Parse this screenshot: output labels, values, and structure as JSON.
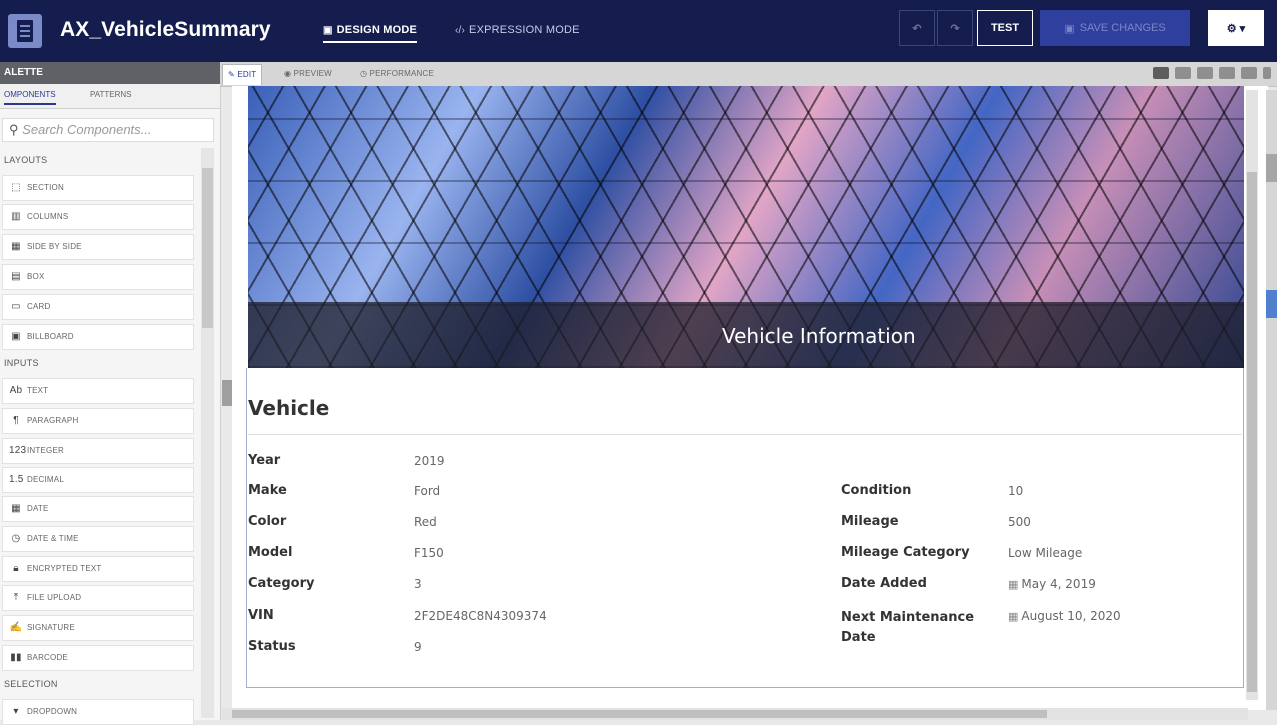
{
  "header": {
    "title": "AX_VehicleSummary",
    "modes": [
      {
        "label": "DESIGN MODE",
        "icon": "design-icon",
        "active": true
      },
      {
        "label": "EXPRESSION MODE",
        "icon": "code-icon",
        "active": false
      }
    ],
    "undo_icon": "undo-icon",
    "redo_icon": "redo-icon",
    "test_label": "TEST",
    "save_label": "SAVE CHANGES",
    "settings_icon": "gear-icon"
  },
  "palette": {
    "title": "ALETTE",
    "tabs": [
      "OMPONENTS",
      "PATTERNS"
    ],
    "search_placeholder": "Search Components...",
    "sections": [
      {
        "label": "LAYOUTS",
        "items": [
          {
            "label": "SECTION",
            "icon": "section-icon"
          },
          {
            "label": "COLUMNS",
            "icon": "columns-icon"
          },
          {
            "label": "SIDE BY SIDE",
            "icon": "side-by-side-icon"
          },
          {
            "label": "BOX",
            "icon": "box-icon"
          },
          {
            "label": "CARD",
            "icon": "card-icon"
          },
          {
            "label": "BILLBOARD",
            "icon": "billboard-icon"
          }
        ]
      },
      {
        "label": "INPUTS",
        "items": [
          {
            "label": "TEXT",
            "icon": "text-icon"
          },
          {
            "label": "PARAGRAPH",
            "icon": "paragraph-icon"
          },
          {
            "label": "INTEGER",
            "icon": "integer-icon"
          },
          {
            "label": "DECIMAL",
            "icon": "decimal-icon"
          },
          {
            "label": "DATE",
            "icon": "date-icon"
          },
          {
            "label": "DATE & TIME",
            "icon": "date-time-icon"
          },
          {
            "label": "ENCRYPTED TEXT",
            "icon": "lock-icon"
          },
          {
            "label": "FILE UPLOAD",
            "icon": "upload-icon"
          },
          {
            "label": "SIGNATURE",
            "icon": "signature-icon"
          },
          {
            "label": "BARCODE",
            "icon": "barcode-icon"
          }
        ]
      },
      {
        "label": "SELECTION",
        "items": [
          {
            "label": "DROPDOWN",
            "icon": "dropdown-icon"
          }
        ]
      }
    ]
  },
  "canvas": {
    "tabs": [
      {
        "label": "EDIT",
        "icon": "edit-icon",
        "active": true
      },
      {
        "label": "PREVIEW",
        "icon": "eye-icon",
        "active": false
      },
      {
        "label": "PERFORMANCE",
        "icon": "clock-icon",
        "active": false
      }
    ],
    "devices": [
      "grid-icon",
      "desktop-icon",
      "laptop-icon",
      "monitor-icon",
      "tablet-icon",
      "phone-icon"
    ]
  },
  "billboard": {
    "title": "Vehicle Information"
  },
  "vehicle": {
    "title": "Vehicle",
    "left_fields": [
      {
        "label": "Year",
        "value": "2019"
      },
      {
        "label": "Make",
        "value": "Ford"
      },
      {
        "label": "Color",
        "value": "Red"
      },
      {
        "label": "Model",
        "value": "F150"
      },
      {
        "label": "Category",
        "value": "3"
      },
      {
        "label": "VIN",
        "value": "2F2DE48C8N4309374"
      },
      {
        "label": "Status",
        "value": "9"
      }
    ],
    "right_fields": [
      {
        "label": "Condition",
        "value": "10"
      },
      {
        "label": "Mileage",
        "value": "500"
      },
      {
        "label": "Mileage Category",
        "value": "Low Mileage"
      },
      {
        "label": "Date Added",
        "value": "May 4, 2019"
      },
      {
        "label": "Next Maintenance Date",
        "value": "August 10, 2020"
      }
    ]
  }
}
